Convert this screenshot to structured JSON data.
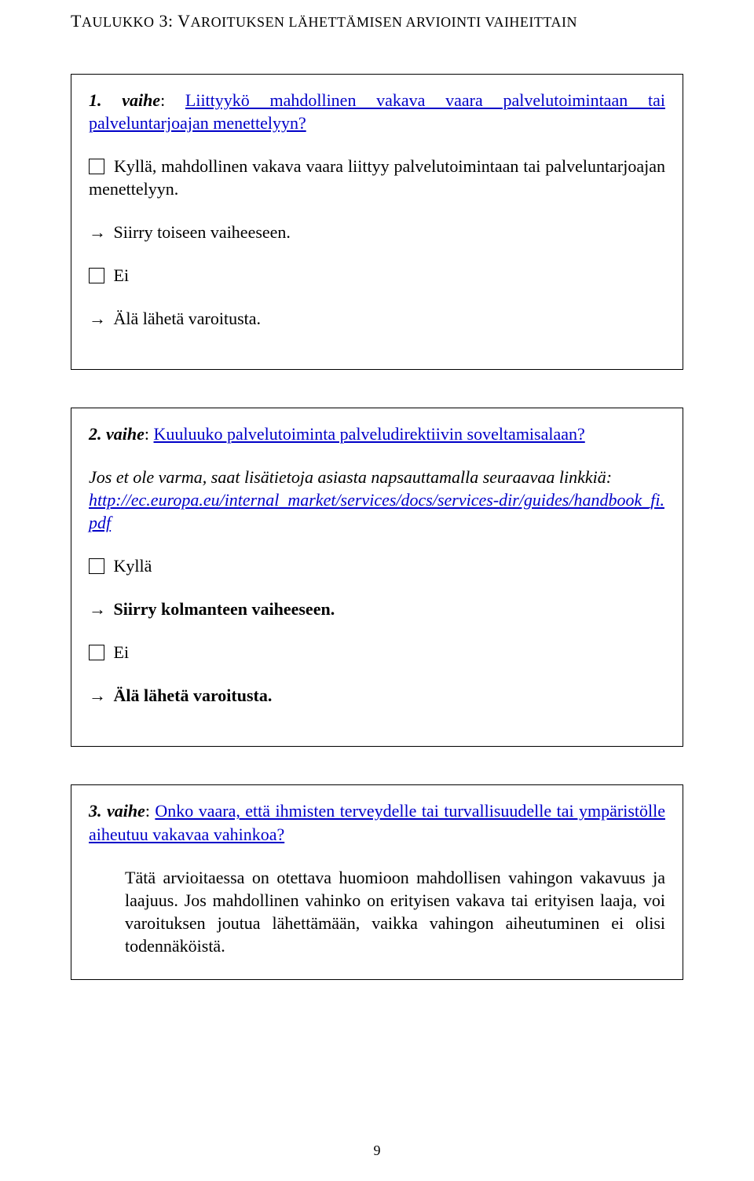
{
  "title": "TAULUKKO 3: VAROITUKSEN LÄHETTÄMISEN ARVIOINTI VAIHEITTAIN",
  "page_number": "9",
  "step1": {
    "prefix": "1. vaihe",
    "heading_link": "Liittyykö mahdollinen vakava vaara palvelutoimintaan tai palveluntarjoajan menettelyyn?",
    "option_yes_text": " Kyllä, mahdollinen vakava vaara liittyy palvelutoimintaan tai palveluntarjoajan menettelyyn.",
    "go_next": " Siirry toiseen vaiheeseen.",
    "option_no": "Ei",
    "no_action": " Älä lähetä varoitusta."
  },
  "step2": {
    "prefix": "2. vaihe",
    "heading_link": "Kuuluuko palvelutoiminta palveludirektiivin soveltamisalaan?",
    "info_text": "Jos et ole varma, saat lisätietoja asiasta napsauttamalla seuraavaa linkkiä:",
    "info_link": "http://ec.europa.eu/internal_market/services/docs/services-dir/guides/handbook_fi.pdf",
    "option_yes": "Kyllä",
    "go_next": " Siirry kolmanteen vaiheeseen.",
    "option_no": "Ei",
    "no_action": " Älä lähetä varoitusta."
  },
  "step3": {
    "prefix": "3. vaihe",
    "heading_link": "Onko vaara, että ihmisten terveydelle tai turvallisuudelle tai ympäristölle aiheutuu vakavaa vahinkoa?",
    "body": "Tätä arvioitaessa on otettava huomioon mahdollisen vahingon vakavuus ja laajuus. Jos mahdollinen vahinko on erityisen vakava tai erityisen laaja, voi varoituksen joutua lähettämään, vaikka vahingon aiheutuminen ei olisi todennäköistä."
  }
}
